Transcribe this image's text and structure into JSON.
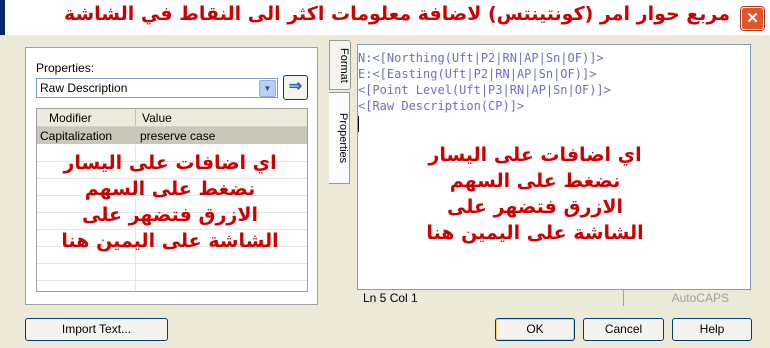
{
  "window": {
    "title": "مربع حوار امر (كونتينتس) لاضافة معلومات اكثر الى النقاط في الشاشة",
    "close_glyph": "✕"
  },
  "left_panel": {
    "properties_label": "Properties:",
    "properties_select": "Raw Description",
    "add_button_glyph": "⇒",
    "grid": {
      "columns": [
        "Modifier",
        "Value"
      ],
      "rows": [
        [
          "Capitalization",
          "preserve case"
        ]
      ]
    }
  },
  "tabs": {
    "format": "Format",
    "properties": "Properties"
  },
  "editor": {
    "lines": [
      "N:<[Northing(Uft|P2|RN|AP|Sn|OF)]>",
      "E:<[Easting(Uft|P2|RN|AP|Sn|OF)]>",
      "<[Point Level(Uft|P3|RN|AP|Sn|OF)]>",
      "<[Raw Description(CP)]>"
    ]
  },
  "status": {
    "position": "Ln 5 Col 1",
    "caps": "AutoCAPS"
  },
  "buttons": {
    "import": "Import Text...",
    "ok": "OK",
    "cancel": "Cancel",
    "help": "Help"
  },
  "annotations": {
    "left": [
      "اي اضافات على اليسار",
      "نضغط على السهم",
      "الازرق  فتضهر على",
      "الشاشة على اليمين هنا"
    ],
    "right": [
      "اي اضافات على اليسار",
      "نضغط على السهم",
      "الازرق  فتضهر على",
      "الشاشة على اليمين هنا"
    ]
  },
  "colors": {
    "annotation": "#cc0000",
    "editor_text": "#6a6fc4",
    "dialog_bg": "#ece9d8",
    "selected_row": "#c9c7ba"
  }
}
